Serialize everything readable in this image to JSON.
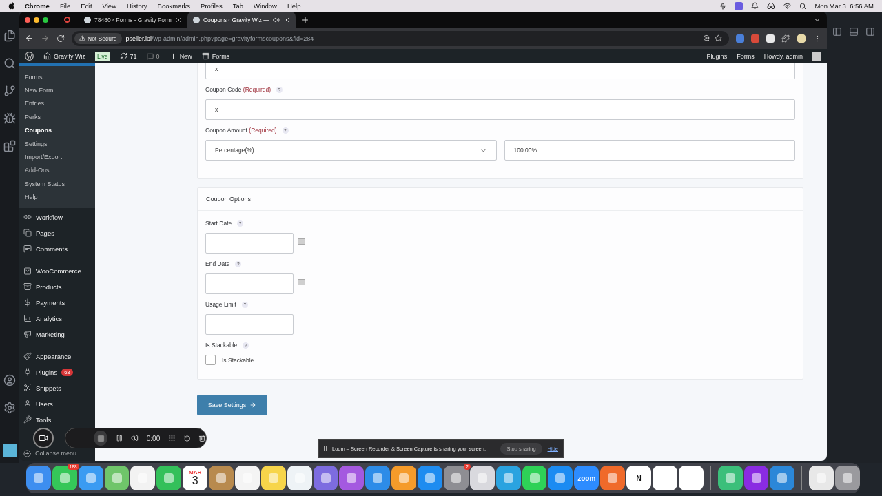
{
  "menubar": {
    "app": "Chrome",
    "menus": [
      "File",
      "Edit",
      "View",
      "History",
      "Bookmarks",
      "Profiles",
      "Tab",
      "Window",
      "Help"
    ],
    "clock": "Mon Mar 3  6:56 AM"
  },
  "browser": {
    "tabs": [
      {
        "title": "78480 ‹ Forms - Gravity Form",
        "selected": false,
        "audio": false
      },
      {
        "title": "Coupons ‹ Gravity Wiz —",
        "selected": true,
        "audio": true
      }
    ],
    "security": "Not Secure",
    "url_host": "pseller.lol",
    "url_path": "/wp-admin/admin.php?page=gravityformscoupons&fid=284"
  },
  "admin_bar": {
    "site": "Gravity Wiz",
    "badge": "Live",
    "updates": "71",
    "comments": "0",
    "new": "New",
    "forms": "Forms",
    "right": [
      "Plugins",
      "Forms"
    ],
    "greeting": "Howdy, admin"
  },
  "sidebar": {
    "submenu": [
      {
        "label": "Forms",
        "selected": false
      },
      {
        "label": "New Form",
        "selected": false
      },
      {
        "label": "Entries",
        "selected": false
      },
      {
        "label": "Perks",
        "selected": false
      },
      {
        "label": "Coupons",
        "selected": true
      },
      {
        "label": "Settings",
        "selected": false
      },
      {
        "label": "Import/Export",
        "selected": false
      },
      {
        "label": "Add-Ons",
        "selected": false
      },
      {
        "label": "System Status",
        "selected": false
      },
      {
        "label": "Help",
        "selected": false
      }
    ],
    "groups": [
      [
        {
          "label": "Workflow"
        },
        {
          "label": "Pages"
        },
        {
          "label": "Comments"
        }
      ],
      [
        {
          "label": "WooCommerce"
        },
        {
          "label": "Products"
        },
        {
          "label": "Payments"
        },
        {
          "label": "Analytics"
        },
        {
          "label": "Marketing"
        }
      ],
      [
        {
          "label": "Appearance"
        },
        {
          "label": "Plugins",
          "badge": "63"
        },
        {
          "label": "Snippets"
        },
        {
          "label": "Users"
        },
        {
          "label": "Tools"
        }
      ]
    ],
    "collapse": "Collapse menu"
  },
  "form": {
    "top_fields": [
      {
        "kind": "text",
        "value": "x"
      },
      {
        "kind": "text",
        "label": "Coupon Code",
        "required": "(Required)",
        "help": "?",
        "value": "x"
      },
      {
        "kind": "amount",
        "label": "Coupon Amount",
        "required": "(Required)",
        "help": "?",
        "select": "Percentage(%)",
        "value": "100.00%"
      }
    ],
    "options_title": "Coupon Options",
    "options": [
      {
        "kind": "date",
        "label": "Start Date",
        "help": "?"
      },
      {
        "kind": "date",
        "label": "End Date",
        "help": "?"
      },
      {
        "kind": "number",
        "label": "Usage Limit",
        "help": "?"
      },
      {
        "kind": "checkbox",
        "label": "Is Stackable",
        "help": "?",
        "option": "Is Stackable",
        "checked": false
      }
    ],
    "save": "Save Settings"
  },
  "loom": {
    "timer": "0:00",
    "notice": "Loom – Screen Recorder & Screen Capture is sharing your screen.",
    "stop": "Stop sharing",
    "hide": "Hide"
  },
  "dock": [
    {
      "kind": "app",
      "color": "#3d8ef0"
    },
    {
      "kind": "app",
      "color": "#35c759",
      "badge": "188"
    },
    {
      "kind": "app",
      "color": "#3a9bf2"
    },
    {
      "kind": "app",
      "color": "#6fc56a"
    },
    {
      "kind": "app",
      "color": "#f2f2f2"
    },
    {
      "kind": "app",
      "color": "#33c05a"
    },
    {
      "kind": "calendar",
      "color": "#ffffff",
      "month": "MAR",
      "day": "3"
    },
    {
      "kind": "app",
      "color": "#b88a4e"
    },
    {
      "kind": "app",
      "color": "#f4f4f4"
    },
    {
      "kind": "app",
      "color": "#f7d54a"
    },
    {
      "kind": "app",
      "color": "#eef3f6"
    },
    {
      "kind": "app",
      "color": "#7d6ce0"
    },
    {
      "kind": "app",
      "color": "#a459e0"
    },
    {
      "kind": "app",
      "color": "#2d8ce8"
    },
    {
      "kind": "app",
      "color": "#f59b2a"
    },
    {
      "kind": "app",
      "color": "#1e8cf0"
    },
    {
      "kind": "app",
      "color": "#8e8e93",
      "badge": "2"
    },
    {
      "kind": "app",
      "color": "#d9d9de"
    },
    {
      "kind": "app",
      "color": "#2aa3e0"
    },
    {
      "kind": "app",
      "color": "#2ed157"
    },
    {
      "kind": "app",
      "color": "#1b8bf2"
    },
    {
      "kind": "app",
      "color": "#2d8cff",
      "label": "zoom"
    },
    {
      "kind": "app",
      "color": "#f06a2a"
    },
    {
      "kind": "app",
      "color": "#ffffff",
      "label": "N"
    },
    {
      "kind": "app",
      "color": "#ffffff"
    },
    {
      "kind": "app",
      "color": "#ffffff"
    },
    {
      "kind": "separator"
    },
    {
      "kind": "app",
      "color": "#3bbf7a"
    },
    {
      "kind": "app",
      "color": "#8a2be2"
    },
    {
      "kind": "app",
      "color": "#2b87d8"
    },
    {
      "kind": "separator"
    },
    {
      "kind": "app",
      "color": "#e8e8e8"
    },
    {
      "kind": "app",
      "color": "#9a9a9e"
    }
  ]
}
